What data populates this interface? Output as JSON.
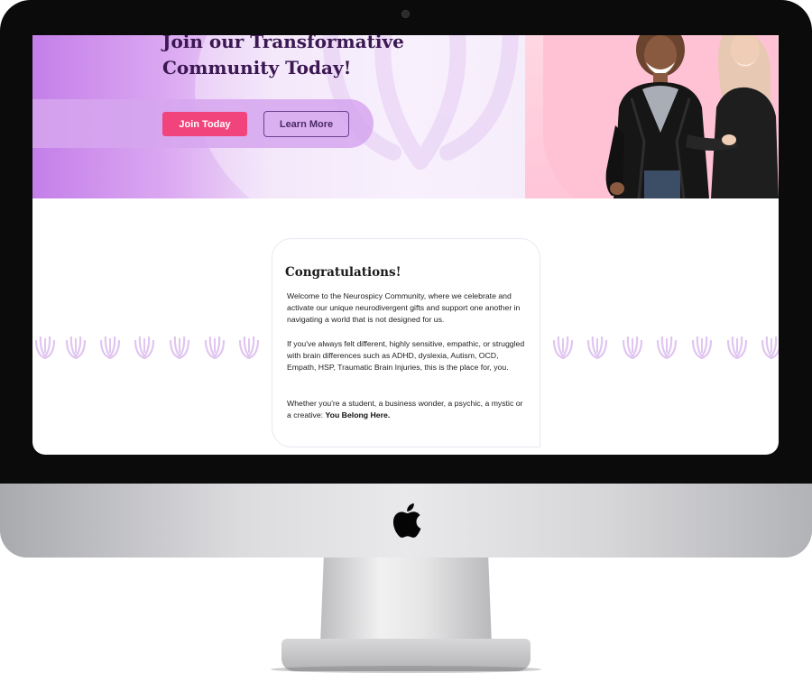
{
  "hero": {
    "title_line1": "Join our Transformative",
    "title_line2": "Community Today!",
    "join_label": "Join Today",
    "learn_label": "Learn More"
  },
  "card": {
    "title": "Congratulations!",
    "p1": "Welcome to the Neurospicy Community, where we celebrate and activate our unique neurodivergent gifts and support one another in navigating a world that is not designed for us.",
    "p2": "If you've always felt different, highly sensitive, empathic, or struggled with brain differences such as ADHD, dyslexia, Autism, OCD, Empath, HSP, Traumatic Brain Injuries, this is the place for, you.",
    "p3_prefix": "Whether you're a student, a business wonder, a psychic, a mystic or a creative: ",
    "p3_bold": "You Belong Here."
  },
  "colors": {
    "accent_pink": "#f2447c",
    "purple_dark": "#3b1852",
    "lavender": "#d6a6ef"
  },
  "icons": [
    "apple-logo-icon",
    "lotus-pattern-icon",
    "lotus-watermark-icon"
  ]
}
